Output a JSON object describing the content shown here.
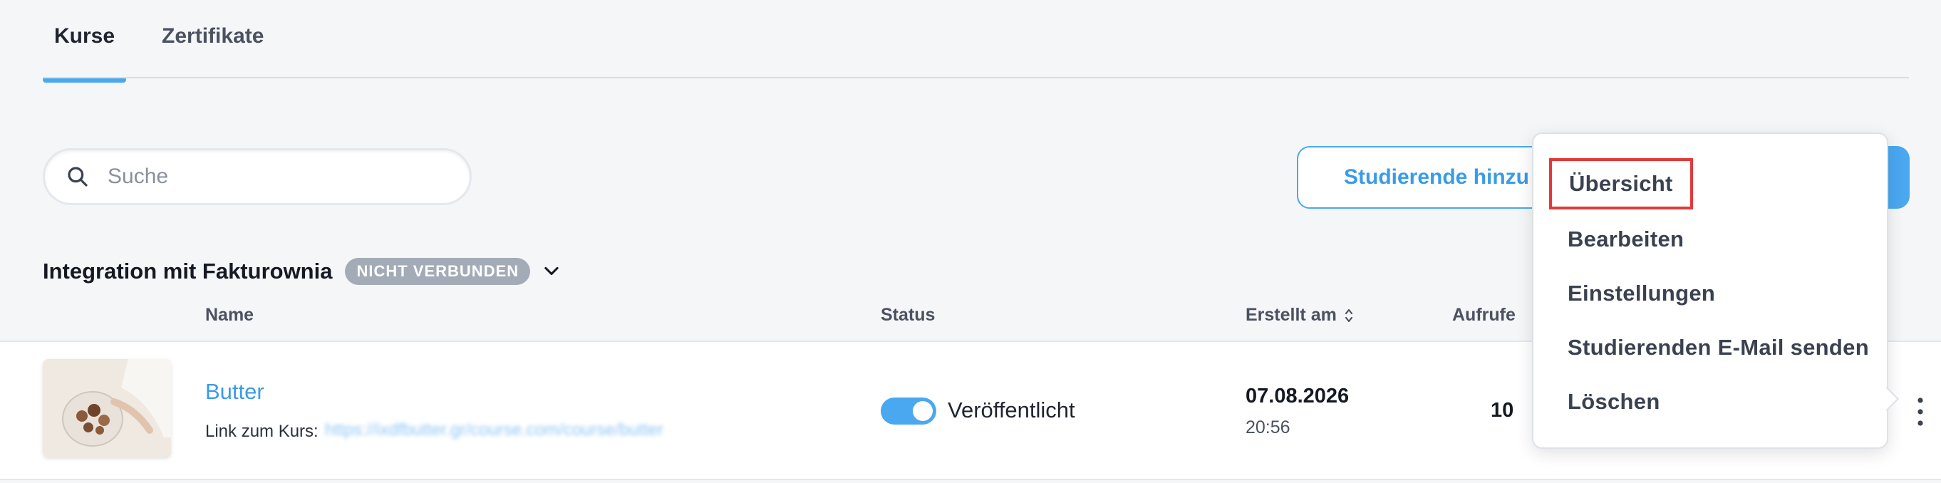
{
  "tabs": [
    {
      "label": "Kurse",
      "active": true
    },
    {
      "label": "Zertifikate",
      "active": false
    }
  ],
  "search": {
    "placeholder": "Suche",
    "value": ""
  },
  "actions": {
    "add_students_label": "Studierende hinzu"
  },
  "integration": {
    "title": "Integration mit Fakturownia",
    "status_badge": "NICHT VERBUNDEN"
  },
  "table": {
    "headers": {
      "name": "Name",
      "status": "Status",
      "created": "Erstellt am",
      "views": "Aufrufe"
    },
    "rows": [
      {
        "title": "Butter",
        "link_label": "Link zum Kurs:",
        "link_url": "https://ixdfbutter.gr/course.com/course/butter",
        "status": "Veröffentlicht",
        "published": true,
        "created_date": "07.08.2026",
        "created_time": "20:56",
        "views": "10"
      }
    ]
  },
  "menu": {
    "items": [
      "Übersicht",
      "Bearbeiten",
      "Einstellungen",
      "Studierenden E-Mail senden",
      "Löschen"
    ],
    "highlighted_index": 0
  },
  "colors": {
    "accent": "#4aa8f0",
    "highlight": "#e23a3a",
    "badge": "#a3abb6"
  }
}
